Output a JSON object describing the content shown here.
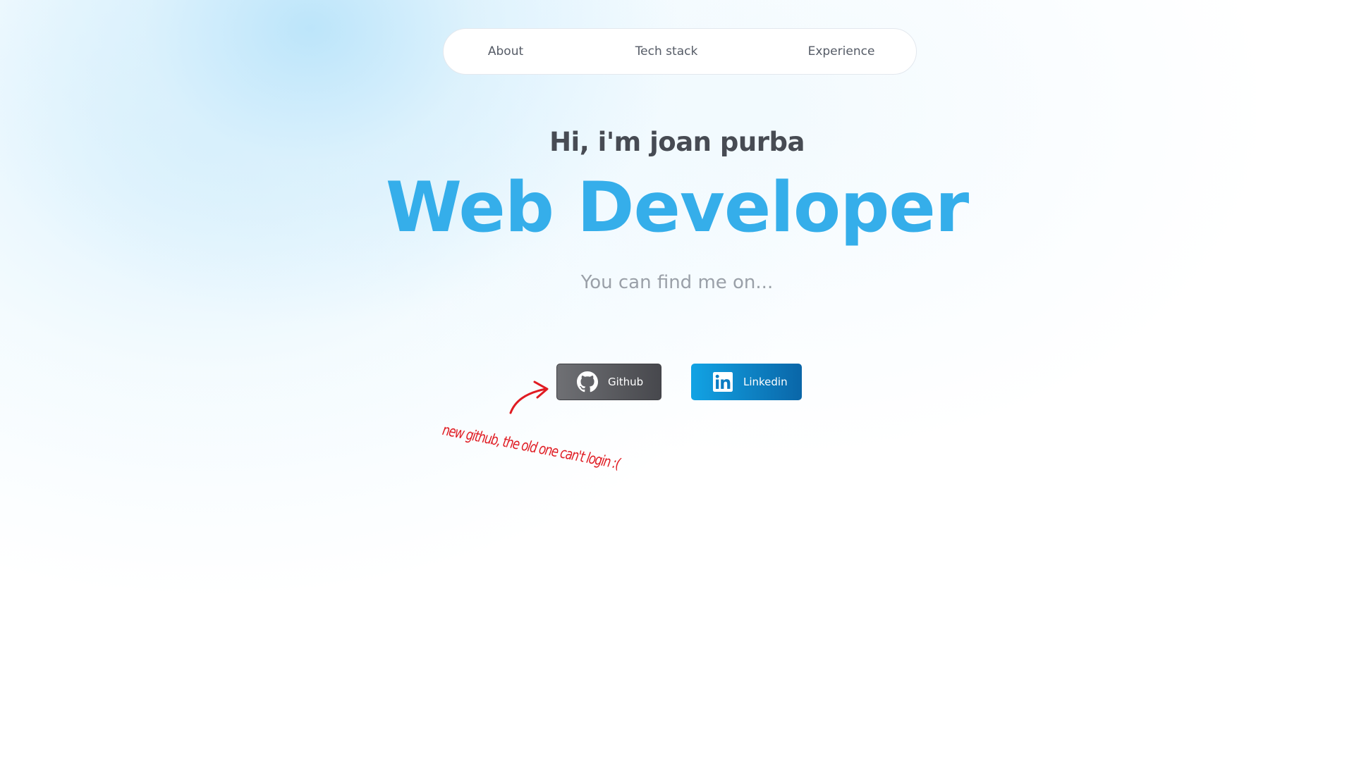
{
  "nav": {
    "items": [
      {
        "label": "About"
      },
      {
        "label": "Tech stack"
      },
      {
        "label": "Experience"
      }
    ]
  },
  "hero": {
    "greeting": "Hi, i'm joan purba",
    "role": "Web Developer",
    "find_text": "You can find me on..."
  },
  "links": {
    "github": {
      "label": "Github",
      "icon": "github-icon"
    },
    "linkedin": {
      "label": "Linkedin",
      "icon": "linkedin-icon"
    }
  },
  "annotation": {
    "text": "new github, the old one can't login :("
  },
  "colors": {
    "accent": "#35aeea",
    "heading": "#474b53",
    "note": "#e01b22",
    "github_button": "#55565b",
    "linkedin_button": "#0a66a8"
  }
}
